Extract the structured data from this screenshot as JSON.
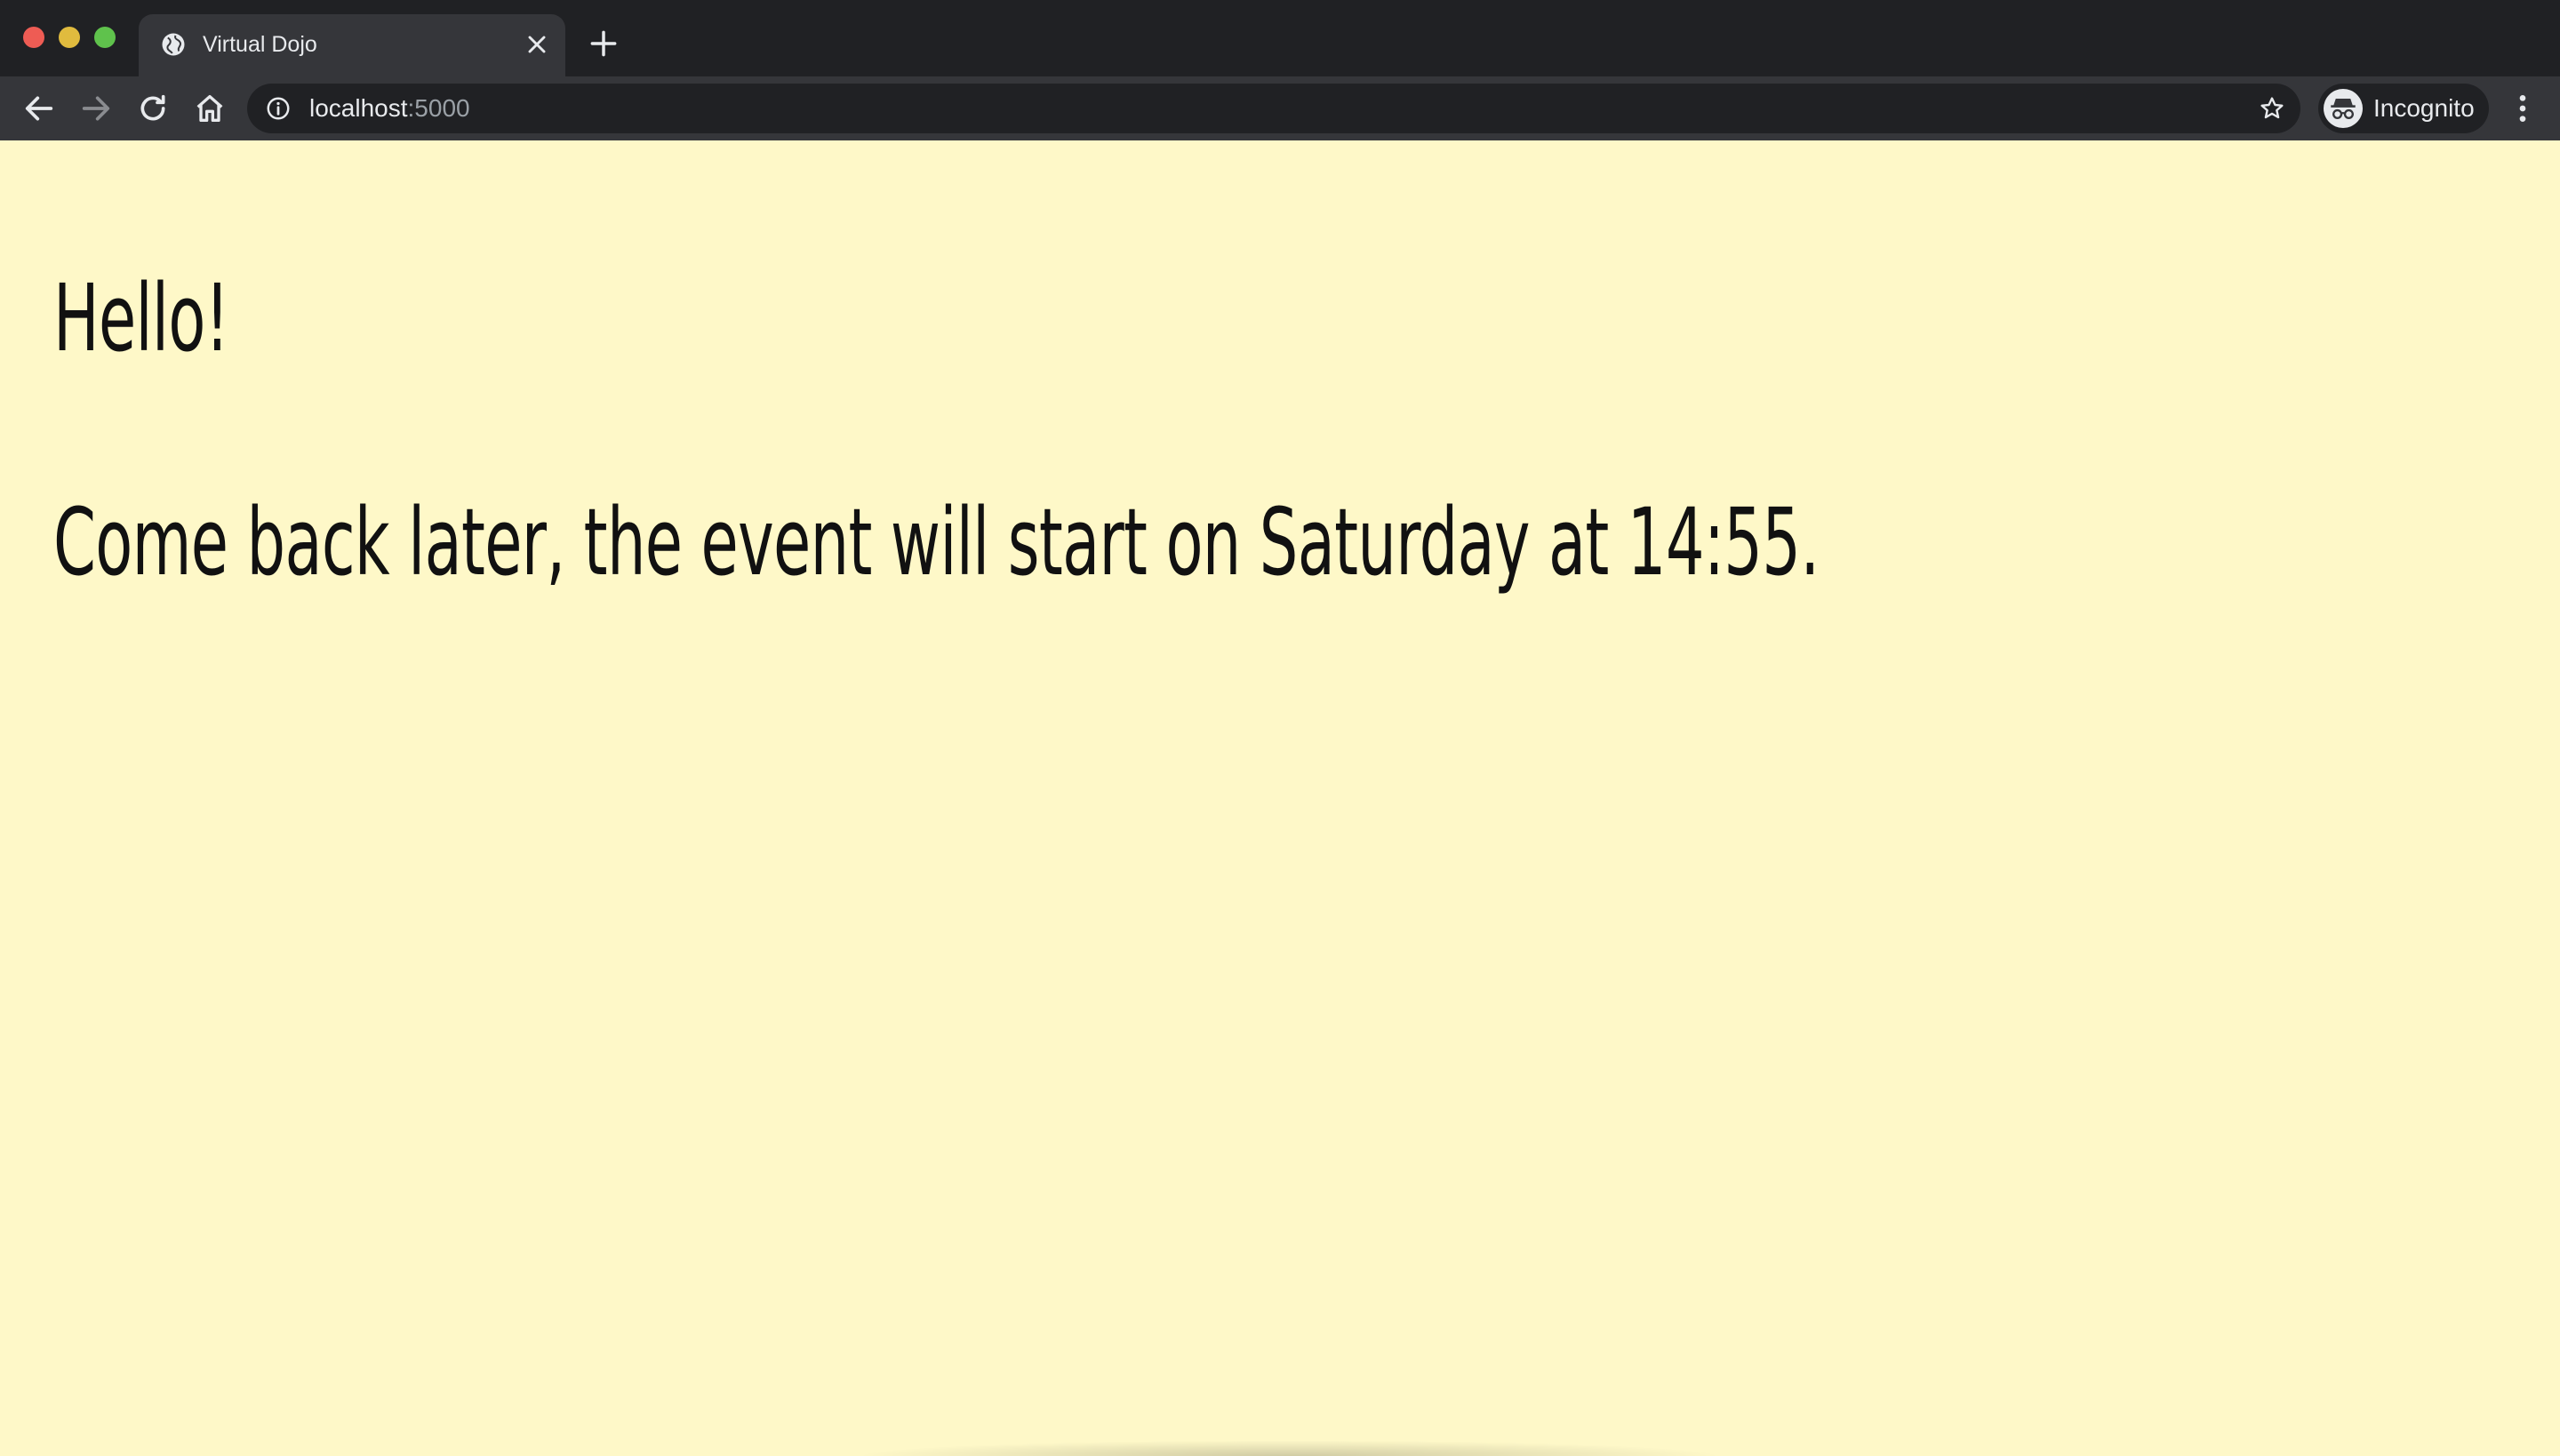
{
  "browser": {
    "tab": {
      "title": "Virtual Dojo",
      "icon": "globe-icon"
    },
    "new_tab_icon": "plus-icon",
    "toolbar": {
      "back_icon": "back-arrow-icon",
      "forward_icon": "forward-arrow-icon",
      "reload_icon": "reload-icon",
      "home_icon": "home-icon",
      "address": {
        "host": "localhost",
        "port": ":5000",
        "security_icon": "info-icon",
        "bookmark_icon": "star-icon"
      },
      "profile_label": "Incognito",
      "profile_icon": "incognito-icon",
      "menu_icon": "kebab-menu-icon"
    },
    "colors": {
      "chrome_dark": "#202124",
      "toolbar": "#35363a",
      "page_background": "#fef8c8",
      "text": "#111111"
    }
  },
  "page": {
    "heading": "Hello!",
    "message": "Come back later, the event will start on Saturday at 14:55."
  }
}
